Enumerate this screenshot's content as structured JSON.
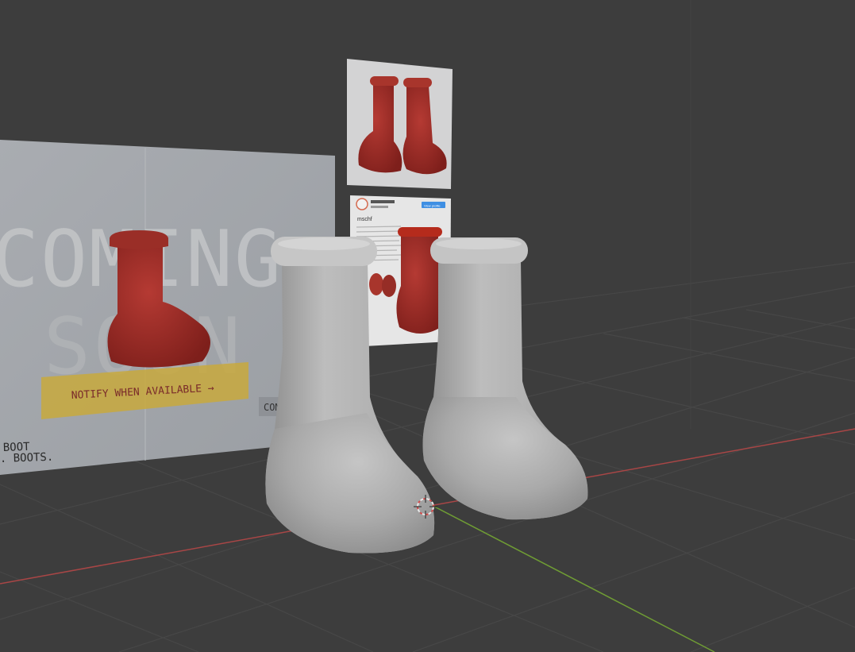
{
  "viewport": {
    "background": "#3d3d3d",
    "floor_color": "#393939",
    "grid_color": "#4a4a4a",
    "x_axis_color": "#b34b4b",
    "y_axis_color": "#79a83a"
  },
  "poster_main": {
    "headline_line1": "COMING",
    "headline_line2": "SOON",
    "cta_label": "NOTIFY WHEN AVAILABLE →",
    "secondary_button_label": "COM",
    "tagline_line1": "BOOT",
    "tagline_line2": ". BOOTS.",
    "boot_color": "#a62b25",
    "cta_color": "#c9a93f"
  },
  "reference_photo": {
    "boot_color": "#a62b25",
    "background": "#d7d7d7"
  },
  "reference_profile": {
    "account_name": "mschf",
    "follow_label": "View profile",
    "boot_color": "#b52b1c"
  },
  "model": {
    "boot_color": "#b9b9b9",
    "icon": "3d-cursor-icon"
  }
}
